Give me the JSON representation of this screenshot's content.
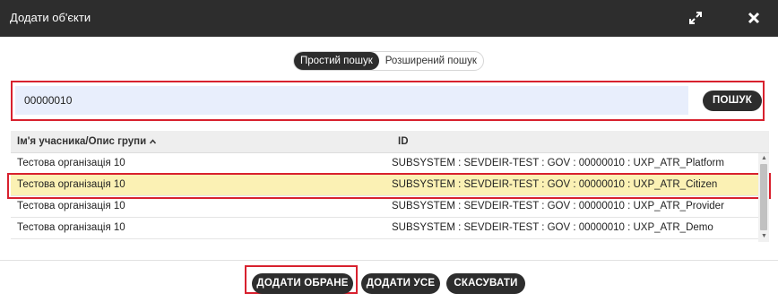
{
  "dialog": {
    "title": "Додати об'єкти",
    "expand_icon": "expand-icon",
    "close_icon": "close-icon"
  },
  "search_mode": {
    "simple_label": "Простий пошук",
    "advanced_label": "Розширений пошук",
    "active": "simple"
  },
  "search": {
    "value": "00000010",
    "button_label": "ПОШУК"
  },
  "table": {
    "columns": {
      "name": "Ім'я учасника/Опис групи",
      "name_sort_icon": "caret-up-icon",
      "id": "ID"
    },
    "rows": [
      {
        "name": "Тестова організація 10",
        "id": "SUBSYSTEM : SEVDEIR-TEST : GOV : 00000010 : UXP_ATR_Platform",
        "selected": false
      },
      {
        "name": "Тестова організація 10",
        "id": "SUBSYSTEM : SEVDEIR-TEST : GOV : 00000010 : UXP_ATR_Citizen",
        "selected": true
      },
      {
        "name": "Тестова організація 10",
        "id": "SUBSYSTEM : SEVDEIR-TEST : GOV : 00000010 : UXP_ATR_Provider",
        "selected": false
      },
      {
        "name": "Тестова організація 10",
        "id": "SUBSYSTEM : SEVDEIR-TEST : GOV : 00000010 : UXP_ATR_Demo",
        "selected": false
      }
    ]
  },
  "footer": {
    "add_selected_label": "ДОДАТИ ОБРАНЕ",
    "add_all_label": "ДОДАТИ УСЕ",
    "cancel_label": "СКАСУВАТИ"
  },
  "colors": {
    "titlebar": "#2d2d2d",
    "highlight": "#d8212e",
    "selected_row": "#fbf1b4",
    "input_bg": "#e8eefc"
  }
}
